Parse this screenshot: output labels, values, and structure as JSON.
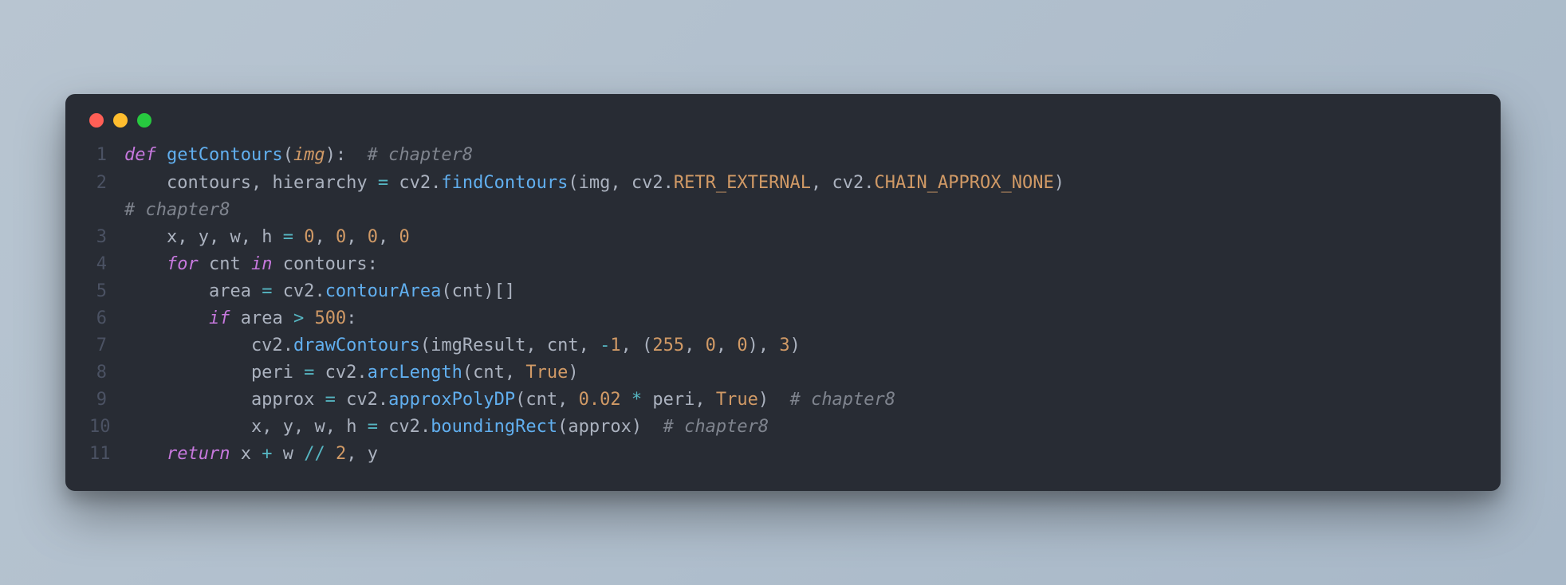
{
  "window": {
    "dots": [
      "close",
      "minimize",
      "zoom"
    ]
  },
  "colors": {
    "bg": "#282c34",
    "red": "#ff5f56",
    "yellow": "#ffbd2e",
    "green": "#27c93f",
    "keyword": "#c678dd",
    "function": "#61afef",
    "param": "#d19a66",
    "comment": "#7f848e",
    "operator": "#56b6c2",
    "text": "#abb2bf"
  },
  "code": {
    "lines": [
      {
        "n": "1",
        "tokens": [
          {
            "t": "kw",
            "v": "def "
          },
          {
            "t": "fn",
            "v": "getContours"
          },
          {
            "t": "pn",
            "v": "("
          },
          {
            "t": "prm",
            "v": "img"
          },
          {
            "t": "pn",
            "v": "):  "
          },
          {
            "t": "cm",
            "v": "# chapter8"
          }
        ]
      },
      {
        "n": "2",
        "tokens": [
          {
            "t": "id",
            "v": "    contours"
          },
          {
            "t": "pn",
            "v": ", "
          },
          {
            "t": "id",
            "v": "hierarchy "
          },
          {
            "t": "op",
            "v": "= "
          },
          {
            "t": "id",
            "v": "cv2"
          },
          {
            "t": "pn",
            "v": "."
          },
          {
            "t": "fn",
            "v": "findContours"
          },
          {
            "t": "pn",
            "v": "("
          },
          {
            "t": "id",
            "v": "img"
          },
          {
            "t": "pn",
            "v": ", "
          },
          {
            "t": "id",
            "v": "cv2"
          },
          {
            "t": "pn",
            "v": "."
          },
          {
            "t": "cn",
            "v": "RETR_EXTERNAL"
          },
          {
            "t": "pn",
            "v": ", "
          },
          {
            "t": "id",
            "v": "cv2"
          },
          {
            "t": "pn",
            "v": "."
          },
          {
            "t": "cn",
            "v": "CHAIN_APPROX_NONE"
          },
          {
            "t": "pn",
            "v": ")  "
          }
        ]
      },
      {
        "n": "",
        "tokens": [
          {
            "t": "cm",
            "v": "# chapter8"
          }
        ]
      },
      {
        "n": "3",
        "tokens": [
          {
            "t": "id",
            "v": "    x"
          },
          {
            "t": "pn",
            "v": ", "
          },
          {
            "t": "id",
            "v": "y"
          },
          {
            "t": "pn",
            "v": ", "
          },
          {
            "t": "id",
            "v": "w"
          },
          {
            "t": "pn",
            "v": ", "
          },
          {
            "t": "id",
            "v": "h "
          },
          {
            "t": "op",
            "v": "= "
          },
          {
            "t": "nm",
            "v": "0"
          },
          {
            "t": "pn",
            "v": ", "
          },
          {
            "t": "nm",
            "v": "0"
          },
          {
            "t": "pn",
            "v": ", "
          },
          {
            "t": "nm",
            "v": "0"
          },
          {
            "t": "pn",
            "v": ", "
          },
          {
            "t": "nm",
            "v": "0"
          }
        ]
      },
      {
        "n": "4",
        "tokens": [
          {
            "t": "id",
            "v": "    "
          },
          {
            "t": "kw",
            "v": "for "
          },
          {
            "t": "id",
            "v": "cnt "
          },
          {
            "t": "kw",
            "v": "in "
          },
          {
            "t": "id",
            "v": "contours"
          },
          {
            "t": "pn",
            "v": ":"
          }
        ]
      },
      {
        "n": "5",
        "tokens": [
          {
            "t": "id",
            "v": "        area "
          },
          {
            "t": "op",
            "v": "= "
          },
          {
            "t": "id",
            "v": "cv2"
          },
          {
            "t": "pn",
            "v": "."
          },
          {
            "t": "fn",
            "v": "contourArea"
          },
          {
            "t": "pn",
            "v": "("
          },
          {
            "t": "id",
            "v": "cnt"
          },
          {
            "t": "pn",
            "v": ")[]"
          }
        ]
      },
      {
        "n": "6",
        "tokens": [
          {
            "t": "id",
            "v": "        "
          },
          {
            "t": "kw",
            "v": "if "
          },
          {
            "t": "id",
            "v": "area "
          },
          {
            "t": "op",
            "v": "> "
          },
          {
            "t": "nm",
            "v": "500"
          },
          {
            "t": "pn",
            "v": ":"
          }
        ]
      },
      {
        "n": "7",
        "tokens": [
          {
            "t": "id",
            "v": "            cv2"
          },
          {
            "t": "pn",
            "v": "."
          },
          {
            "t": "fn",
            "v": "drawContours"
          },
          {
            "t": "pn",
            "v": "("
          },
          {
            "t": "id",
            "v": "imgResult"
          },
          {
            "t": "pn",
            "v": ", "
          },
          {
            "t": "id",
            "v": "cnt"
          },
          {
            "t": "pn",
            "v": ", "
          },
          {
            "t": "op",
            "v": "-"
          },
          {
            "t": "nm",
            "v": "1"
          },
          {
            "t": "pn",
            "v": ", ("
          },
          {
            "t": "nm",
            "v": "255"
          },
          {
            "t": "pn",
            "v": ", "
          },
          {
            "t": "nm",
            "v": "0"
          },
          {
            "t": "pn",
            "v": ", "
          },
          {
            "t": "nm",
            "v": "0"
          },
          {
            "t": "pn",
            "v": "), "
          },
          {
            "t": "nm",
            "v": "3"
          },
          {
            "t": "pn",
            "v": ")"
          }
        ]
      },
      {
        "n": "8",
        "tokens": [
          {
            "t": "id",
            "v": "            peri "
          },
          {
            "t": "op",
            "v": "= "
          },
          {
            "t": "id",
            "v": "cv2"
          },
          {
            "t": "pn",
            "v": "."
          },
          {
            "t": "fn",
            "v": "arcLength"
          },
          {
            "t": "pn",
            "v": "("
          },
          {
            "t": "id",
            "v": "cnt"
          },
          {
            "t": "pn",
            "v": ", "
          },
          {
            "t": "bl",
            "v": "True"
          },
          {
            "t": "pn",
            "v": ")"
          }
        ]
      },
      {
        "n": "9",
        "tokens": [
          {
            "t": "id",
            "v": "            approx "
          },
          {
            "t": "op",
            "v": "= "
          },
          {
            "t": "id",
            "v": "cv2"
          },
          {
            "t": "pn",
            "v": "."
          },
          {
            "t": "fn",
            "v": "approxPolyDP"
          },
          {
            "t": "pn",
            "v": "("
          },
          {
            "t": "id",
            "v": "cnt"
          },
          {
            "t": "pn",
            "v": ", "
          },
          {
            "t": "nm",
            "v": "0.02"
          },
          {
            "t": "id",
            "v": " "
          },
          {
            "t": "op",
            "v": "*"
          },
          {
            "t": "id",
            "v": " peri"
          },
          {
            "t": "pn",
            "v": ", "
          },
          {
            "t": "bl",
            "v": "True"
          },
          {
            "t": "pn",
            "v": ")  "
          },
          {
            "t": "cm",
            "v": "# chapter8"
          }
        ]
      },
      {
        "n": "10",
        "tokens": [
          {
            "t": "id",
            "v": "            x"
          },
          {
            "t": "pn",
            "v": ", "
          },
          {
            "t": "id",
            "v": "y"
          },
          {
            "t": "pn",
            "v": ", "
          },
          {
            "t": "id",
            "v": "w"
          },
          {
            "t": "pn",
            "v": ", "
          },
          {
            "t": "id",
            "v": "h "
          },
          {
            "t": "op",
            "v": "= "
          },
          {
            "t": "id",
            "v": "cv2"
          },
          {
            "t": "pn",
            "v": "."
          },
          {
            "t": "fn",
            "v": "boundingRect"
          },
          {
            "t": "pn",
            "v": "("
          },
          {
            "t": "id",
            "v": "approx"
          },
          {
            "t": "pn",
            "v": ")  "
          },
          {
            "t": "cm",
            "v": "# chapter8"
          }
        ]
      },
      {
        "n": "11",
        "tokens": [
          {
            "t": "id",
            "v": "    "
          },
          {
            "t": "kw",
            "v": "return "
          },
          {
            "t": "id",
            "v": "x "
          },
          {
            "t": "op",
            "v": "+"
          },
          {
            "t": "id",
            "v": " w "
          },
          {
            "t": "op",
            "v": "//"
          },
          {
            "t": "id",
            "v": " "
          },
          {
            "t": "nm",
            "v": "2"
          },
          {
            "t": "pn",
            "v": ", "
          },
          {
            "t": "id",
            "v": "y"
          }
        ]
      }
    ]
  }
}
